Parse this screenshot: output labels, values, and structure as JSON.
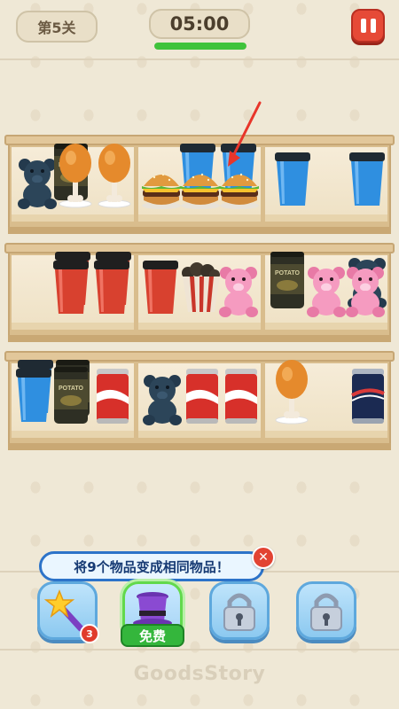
{
  "header": {
    "level_label": "第5关",
    "timer": "05:00",
    "timer_progress": 1.0
  },
  "shelves": [
    [
      "teddy-bear-navy",
      "potato-chips-can",
      "roast-chicken-leg",
      "roast-chicken-leg",
      "burger",
      "burger",
      "burger",
      "blue-coffee-cup",
      "blue-coffee-cup"
    ],
    [
      "red-coffee-cup",
      "red-coffee-cup",
      "red-coffee-cup",
      "popcorn-bucket",
      "teddy-bear-pink",
      "potato-chips-can",
      "teddy-bear-pink",
      "teddy-bear-pink"
    ],
    [
      "blue-coffee-cup",
      "potato-chips-can",
      "cola-can",
      "teddy-bear-navy",
      "cola-can",
      "cola-can",
      "roast-chicken-leg",
      "navy-soda-can"
    ]
  ],
  "tooltip": {
    "text": "将9个物品变成相同物品！"
  },
  "powerups": {
    "magic_wand_count": "3",
    "magic_hat_label": "免费"
  },
  "brand": "GoodsStory",
  "colors": {
    "accent_red": "#e64a37",
    "timer_green": "#3fc33b",
    "tooltip_blue": "#2c73c9",
    "free_green": "#34b63c"
  }
}
